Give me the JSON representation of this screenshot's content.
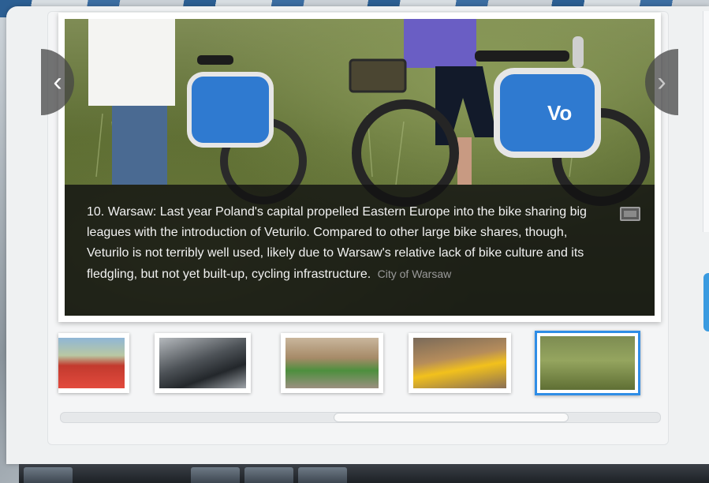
{
  "slide": {
    "caption": "10. Warsaw: Last year Poland's capital propelled Eastern Europe into the bike sharing big leagues with the introduction of Veturilo. Compared to other large bike shares, though, Veturilo is not terribly well used, likely due to Warsaw's relative lack of bike culture and its fledgling, but not yet built-up, cycling infrastructure.",
    "credit": "City of Warsaw"
  },
  "nav": {
    "prev_icon": "chevron-left-icon",
    "next_icon": "chevron-right-icon",
    "prev_glyph": "‹",
    "next_glyph": "›"
  },
  "thumbnails": [
    {
      "subject": "red-bikes-row",
      "active": false
    },
    {
      "subject": "black-bike-closeup",
      "active": false
    },
    {
      "subject": "green-bikes-street",
      "active": false
    },
    {
      "subject": "yellow-bikes-dock",
      "active": false
    },
    {
      "subject": "warsaw-bikes-grass",
      "active": true
    }
  ],
  "colors": {
    "active_thumb_border": "#2f8de6",
    "caption_bg": "#121212",
    "side_tab": "#3a9be0"
  }
}
